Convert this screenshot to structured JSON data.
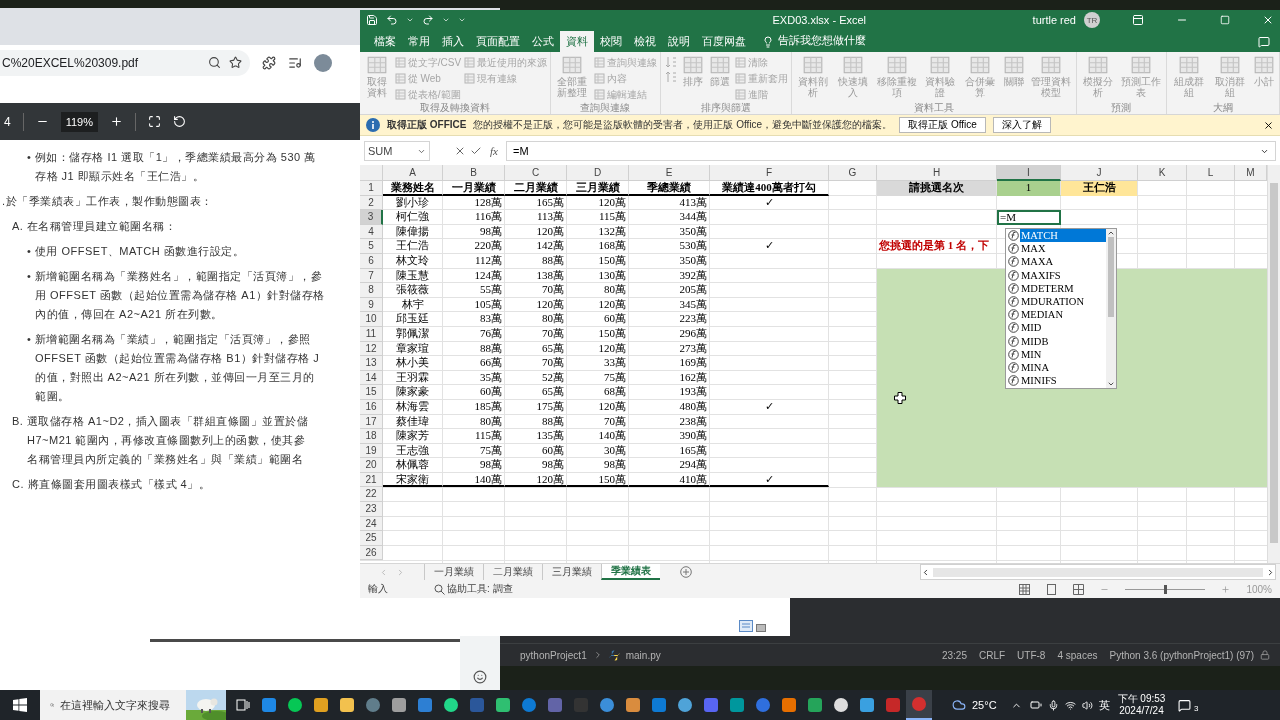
{
  "browser": {
    "url": "C%20EXCEL%20309.pdf",
    "page": "4",
    "zoom": "119%",
    "lines": [
      {
        "kind": "bullet",
        "text": "• 例如：儲存格 I1 選取「1」，季總業績最高分為 530 萬"
      },
      {
        "kind": "bullet-cont",
        "text": "存格 J1 即顯示姓名「王仁浩」。"
      },
      {
        "kind": "step",
        "text": ".於「季業績表」工作表，製作動態圖表："
      },
      {
        "kind": "section",
        "text": "A. 在名稱管理員建立範圍名稱："
      },
      {
        "kind": "bullet",
        "text": "• 使用 OFFSET、MATCH 函數進行設定。"
      },
      {
        "kind": "bullet",
        "text": "• 新增範圍名稱為「業務姓名」，範圍指定「活頁簿」，參"
      },
      {
        "kind": "bullet-cont",
        "text": "用 OFFSET 函數（起始位置需為儲存格 A1）針對儲存格"
      },
      {
        "kind": "bullet-cont",
        "text": "內的值，傳回在 A2~A21 所在列數。"
      },
      {
        "kind": "bullet",
        "text": "• 新增範圍名稱為「業績」，範圍指定「活頁簿」，參照"
      },
      {
        "kind": "bullet-cont",
        "text": "OFFSET 函數（起始位置需為儲存格 B1）針對儲存格 J"
      },
      {
        "kind": "bullet-cont",
        "text": "的值，對照出 A2~A21 所在列數，並傳回一月至三月的"
      },
      {
        "kind": "bullet-cont",
        "text": "範圍。"
      },
      {
        "kind": "section",
        "text": "B. 選取儲存格 A1~D2，插入圖表「群組直條圖」並置於儲"
      },
      {
        "kind": "section-cont",
        "text": "H7~M21 範圍內，再修改直條圖數列上的函數，使其參"
      },
      {
        "kind": "section-cont",
        "text": "名稱管理員內所定義的「業務姓名」與「業績」範圍名"
      },
      {
        "kind": "section",
        "text": "C. 將直條圖套用圖表樣式「樣式 4」。"
      }
    ]
  },
  "excel": {
    "title": "EXD03.xlsx - Excel",
    "user": "turtle red",
    "avatar": "TR",
    "tabs": [
      {
        "label": "檔案",
        "selected": false
      },
      {
        "label": "常用",
        "selected": false
      },
      {
        "label": "插入",
        "selected": false
      },
      {
        "label": "頁面配置",
        "selected": false
      },
      {
        "label": "公式",
        "selected": false
      },
      {
        "label": "資料",
        "selected": true
      },
      {
        "label": "校閱",
        "selected": false
      },
      {
        "label": "檢視",
        "selected": false
      },
      {
        "label": "說明",
        "selected": false
      },
      {
        "label": "百度网盘",
        "selected": false
      }
    ],
    "tell_me": "告訴我您想做什麼",
    "ribbon": [
      {
        "label": "取得及轉換資料",
        "commands": [
          {
            "kind": "large",
            "label": "取得資料"
          },
          {
            "kind": "small",
            "label": "從文字/CSV"
          },
          {
            "kind": "small",
            "label": "從 Web"
          },
          {
            "kind": "small",
            "label": "從表格/範圍"
          },
          {
            "kind": "small",
            "label": "最近使用的來源"
          },
          {
            "kind": "small",
            "label": "現有連線"
          }
        ]
      },
      {
        "label": "查詢與連線",
        "commands": [
          {
            "kind": "large",
            "label": "全部重新整理"
          },
          {
            "kind": "small",
            "label": "查詢與連線"
          },
          {
            "kind": "small",
            "label": "內容"
          },
          {
            "kind": "small",
            "label": "編輯連結"
          }
        ]
      },
      {
        "label": "排序與篩選",
        "commands": [
          {
            "kind": "sort"
          },
          {
            "kind": "large",
            "label": "排序"
          },
          {
            "kind": "large",
            "label": "篩選"
          },
          {
            "kind": "small",
            "label": "清除"
          },
          {
            "kind": "small",
            "label": "重新套用"
          },
          {
            "kind": "small",
            "label": "進階"
          }
        ]
      },
      {
        "label": "資料工具",
        "commands": [
          {
            "kind": "large",
            "label": "資料剖析"
          },
          {
            "kind": "large",
            "label": "快速填入"
          },
          {
            "kind": "large",
            "label": "移除重複項"
          },
          {
            "kind": "large",
            "label": "資料驗證"
          },
          {
            "kind": "large",
            "label": "合併彙算"
          },
          {
            "kind": "large",
            "label": "關聯"
          },
          {
            "kind": "large",
            "label": "管理資料模型"
          }
        ]
      },
      {
        "label": "預測",
        "commands": [
          {
            "kind": "large",
            "label": "模擬分析"
          },
          {
            "kind": "large",
            "label": "預測工作表"
          }
        ]
      },
      {
        "label": "大綱",
        "commands": [
          {
            "kind": "large",
            "label": "組成群組"
          },
          {
            "kind": "large",
            "label": "取消群組"
          },
          {
            "kind": "large",
            "label": "小計"
          }
        ]
      }
    ],
    "notice": {
      "title": "取得正版 OFFICE",
      "message": "您的授權不是正版，您可能是盜版軟體的受害者，使用正版 Office，避免中斷並保護您的檔案。",
      "buttons": [
        "取得正版 Office",
        "深入了解"
      ]
    },
    "name_box": "SUM",
    "function_button": "fx",
    "formula": "=M",
    "columns": [
      {
        "label": "A",
        "selected": false
      },
      {
        "label": "B",
        "selected": false
      },
      {
        "label": "C",
        "selected": false
      },
      {
        "label": "D",
        "selected": false
      },
      {
        "label": "E",
        "selected": false
      },
      {
        "label": "F",
        "selected": false
      },
      {
        "label": "G",
        "selected": false
      },
      {
        "label": "H",
        "selected": false
      },
      {
        "label": "I",
        "selected": true
      },
      {
        "label": "J",
        "selected": false
      },
      {
        "label": "K",
        "selected": false
      },
      {
        "label": "L",
        "selected": false
      },
      {
        "label": "M",
        "selected": false
      }
    ],
    "row_headers": [
      {
        "label": "1",
        "selected": false
      },
      {
        "label": "2",
        "selected": false
      },
      {
        "label": "3",
        "selected": true
      },
      {
        "label": "4",
        "selected": false
      },
      {
        "label": "5",
        "selected": false
      },
      {
        "label": "6",
        "selected": false
      },
      {
        "label": "7",
        "selected": false
      },
      {
        "label": "8",
        "selected": false
      },
      {
        "label": "9",
        "selected": false
      },
      {
        "label": "10",
        "selected": false
      },
      {
        "label": "11",
        "selected": false
      },
      {
        "label": "12",
        "selected": false
      },
      {
        "label": "13",
        "selected": false
      },
      {
        "label": "14",
        "selected": false
      },
      {
        "label": "15",
        "selected": false
      },
      {
        "label": "16",
        "selected": false
      },
      {
        "label": "17",
        "selected": false
      },
      {
        "label": "18",
        "selected": false
      },
      {
        "label": "19",
        "selected": false
      },
      {
        "label": "20",
        "selected": false
      },
      {
        "label": "21",
        "selected": false
      },
      {
        "label": "22",
        "selected": false
      },
      {
        "label": "23",
        "selected": false
      },
      {
        "label": "24",
        "selected": false
      },
      {
        "label": "25",
        "selected": false
      },
      {
        "label": "26",
        "selected": false
      }
    ],
    "table": {
      "header": [
        "業務姓名",
        "一月業績",
        "二月業績",
        "三月業績",
        "季總業績",
        "業績達400萬者打勾"
      ],
      "rows": [
        {
          "cells": [
            "劉小珍",
            "128萬",
            "165萬",
            "120萬",
            "413萬"
          ],
          "column_f": "✓"
        },
        {
          "cells": [
            "柯仁強",
            "116萬",
            "113萬",
            "115萬",
            "344萬"
          ]
        },
        {
          "cells": [
            "陳偉揚",
            "98萬",
            "120萬",
            "132萬",
            "350萬"
          ]
        },
        {
          "cells": [
            "王仁浩",
            "220萬",
            "142萬",
            "168萬",
            "530萬"
          ],
          "column_f": "✓"
        },
        {
          "cells": [
            "林文玲",
            "112萬",
            "88萬",
            "150萬",
            "350萬"
          ]
        },
        {
          "cells": [
            "陳玉慧",
            "124萬",
            "138萬",
            "130萬",
            "392萬"
          ]
        },
        {
          "cells": [
            "張筱薇",
            "55萬",
            "70萬",
            "80萬",
            "205萬"
          ]
        },
        {
          "cells": [
            "林宇",
            "105萬",
            "120萬",
            "120萬",
            "345萬"
          ]
        },
        {
          "cells": [
            "邱玉廷",
            "83萬",
            "80萬",
            "60萬",
            "223萬"
          ]
        },
        {
          "cells": [
            "郭佩潔",
            "76萬",
            "70萬",
            "150萬",
            "296萬"
          ]
        },
        {
          "cells": [
            "章家瑄",
            "88萬",
            "65萬",
            "120萬",
            "273萬"
          ]
        },
        {
          "cells": [
            "林小美",
            "66萬",
            "70萬",
            "33萬",
            "169萬"
          ]
        },
        {
          "cells": [
            "王羽霖",
            "35萬",
            "52萬",
            "75萬",
            "162萬"
          ]
        },
        {
          "cells": [
            "陳家豪",
            "60萬",
            "65萬",
            "68萬",
            "193萬"
          ]
        },
        {
          "cells": [
            "林海雲",
            "185萬",
            "175萬",
            "120萬",
            "480萬"
          ],
          "column_f": "✓"
        },
        {
          "cells": [
            "蔡佳瑋",
            "80萬",
            "88萬",
            "70萬",
            "238萬"
          ]
        },
        {
          "cells": [
            "陳家芳",
            "115萬",
            "135萬",
            "140萬",
            "390萬"
          ]
        },
        {
          "cells": [
            "王志強",
            "75萬",
            "60萬",
            "30萬",
            "165萬"
          ]
        },
        {
          "cells": [
            "林佩蓉",
            "98萬",
            "98萬",
            "98萬",
            "294萬"
          ]
        },
        {
          "cells": [
            "宋家衛",
            "140萬",
            "120萬",
            "150萬",
            "410萬"
          ],
          "column_f": "✓"
        }
      ]
    },
    "selector": {
      "label": "請挑選名次",
      "rank": "1",
      "name": "王仁浩"
    },
    "active_cell": "=M",
    "message": "您挑選的是第 1 名，下",
    "autocomplete": [
      {
        "label": "MATCH",
        "selected": true
      },
      {
        "label": "MAX",
        "selected": false
      },
      {
        "label": "MAXA",
        "selected": false
      },
      {
        "label": "MAXIFS",
        "selected": false
      },
      {
        "label": "MDETERM",
        "selected": false
      },
      {
        "label": "MDURATION",
        "selected": false
      },
      {
        "label": "MEDIAN",
        "selected": false
      },
      {
        "label": "MID",
        "selected": false
      },
      {
        "label": "MIDB",
        "selected": false
      },
      {
        "label": "MIN",
        "selected": false
      },
      {
        "label": "MINA",
        "selected": false
      },
      {
        "label": "MINIFS",
        "selected": false
      }
    ],
    "sheet_tabs": [
      {
        "label": "一月業績",
        "selected": false
      },
      {
        "label": "二月業績",
        "selected": false
      },
      {
        "label": "三月業績",
        "selected": false
      },
      {
        "label": "季業績表",
        "selected": true
      }
    ],
    "status": {
      "mode": "輸入",
      "accessibility": "協助工具: 調查",
      "zoom": "100%",
      "zoom_slider": {
        "level": 0.5
      }
    }
  },
  "ide": {
    "breadcrumb": [
      "pythonProject1",
      "main.py"
    ],
    "status": [
      "23:25",
      "CRLF",
      "UTF-8",
      "4 spaces",
      "Python 3.6 (pythonProject1) (97)"
    ]
  },
  "taskbar": {
    "search": {
      "placeholder": "在這裡輸入文字來搜尋"
    },
    "temperature": "25°C",
    "input_method": "英",
    "time": "下午 09:53",
    "date": "2024/7/24",
    "notifications": "3"
  }
}
